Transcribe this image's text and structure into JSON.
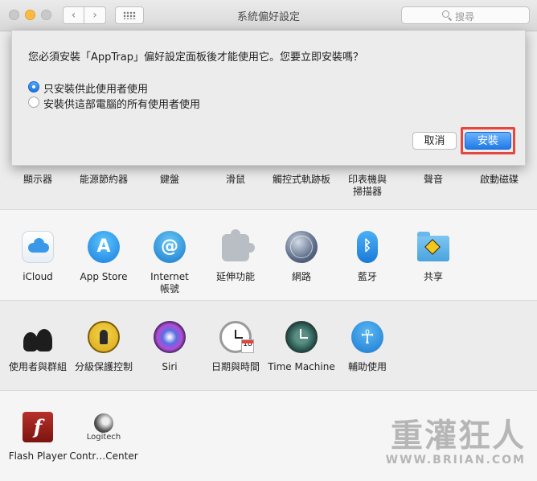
{
  "window": {
    "title": "系統偏好設定",
    "search_placeholder": "搜尋",
    "back_glyph": "‹",
    "forward_glyph": "›"
  },
  "dialog": {
    "message": "您必須安裝「AppTrap」偏好設定面板後才能使用它。您要立即安裝嗎？",
    "options": [
      {
        "label": "只安裝供此使用者使用",
        "selected": true
      },
      {
        "label": "安裝供這部電腦的所有使用者使用",
        "selected": false
      }
    ],
    "cancel_label": "取消",
    "install_label": "安裝",
    "highlight_color": "#e8453c"
  },
  "rows": [
    {
      "panes": [
        {
          "label": "顯示器"
        },
        {
          "label": "能源節約器"
        },
        {
          "label": "鍵盤"
        },
        {
          "label": "滑鼠"
        },
        {
          "label": "觸控式軌跡板"
        },
        {
          "label": "印表機與\n掃描器"
        },
        {
          "label": "聲音"
        },
        {
          "label": "啟動磁碟"
        }
      ]
    },
    {
      "panes": [
        {
          "label": "iCloud",
          "icon": "icloud-icon"
        },
        {
          "label": "App Store",
          "icon": "app-store-icon"
        },
        {
          "label": "Internet\n帳號",
          "icon": "internet-accounts-icon"
        },
        {
          "label": "延伸功能",
          "icon": "extensions-icon"
        },
        {
          "label": "網路",
          "icon": "network-icon"
        },
        {
          "label": "藍牙",
          "icon": "bluetooth-icon"
        },
        {
          "label": "共享",
          "icon": "sharing-icon"
        }
      ]
    },
    {
      "panes": [
        {
          "label": "使用者與群組",
          "icon": "users-groups-icon"
        },
        {
          "label": "分級保護控制",
          "icon": "parental-controls-icon"
        },
        {
          "label": "Siri",
          "icon": "siri-icon"
        },
        {
          "label": "日期與時間",
          "icon": "date-time-icon"
        },
        {
          "label": "Time Machine",
          "icon": "time-machine-icon"
        },
        {
          "label": "輔助使用",
          "icon": "accessibility-icon"
        }
      ]
    },
    {
      "panes": [
        {
          "label": "Flash Player",
          "icon": "flash-player-icon"
        },
        {
          "label": "Contr…Center",
          "icon": "logitech-control-center-icon",
          "icon_text": "Logitech"
        }
      ]
    }
  ],
  "glyphs": {
    "app_store": "A",
    "internet": "@",
    "bluetooth": "ᛒ",
    "accessibility": "☥",
    "flash": "f",
    "calendar_day": "18"
  },
  "watermark": {
    "title": "重灌狂人",
    "url": "WWW.BRIIAN.COM"
  }
}
